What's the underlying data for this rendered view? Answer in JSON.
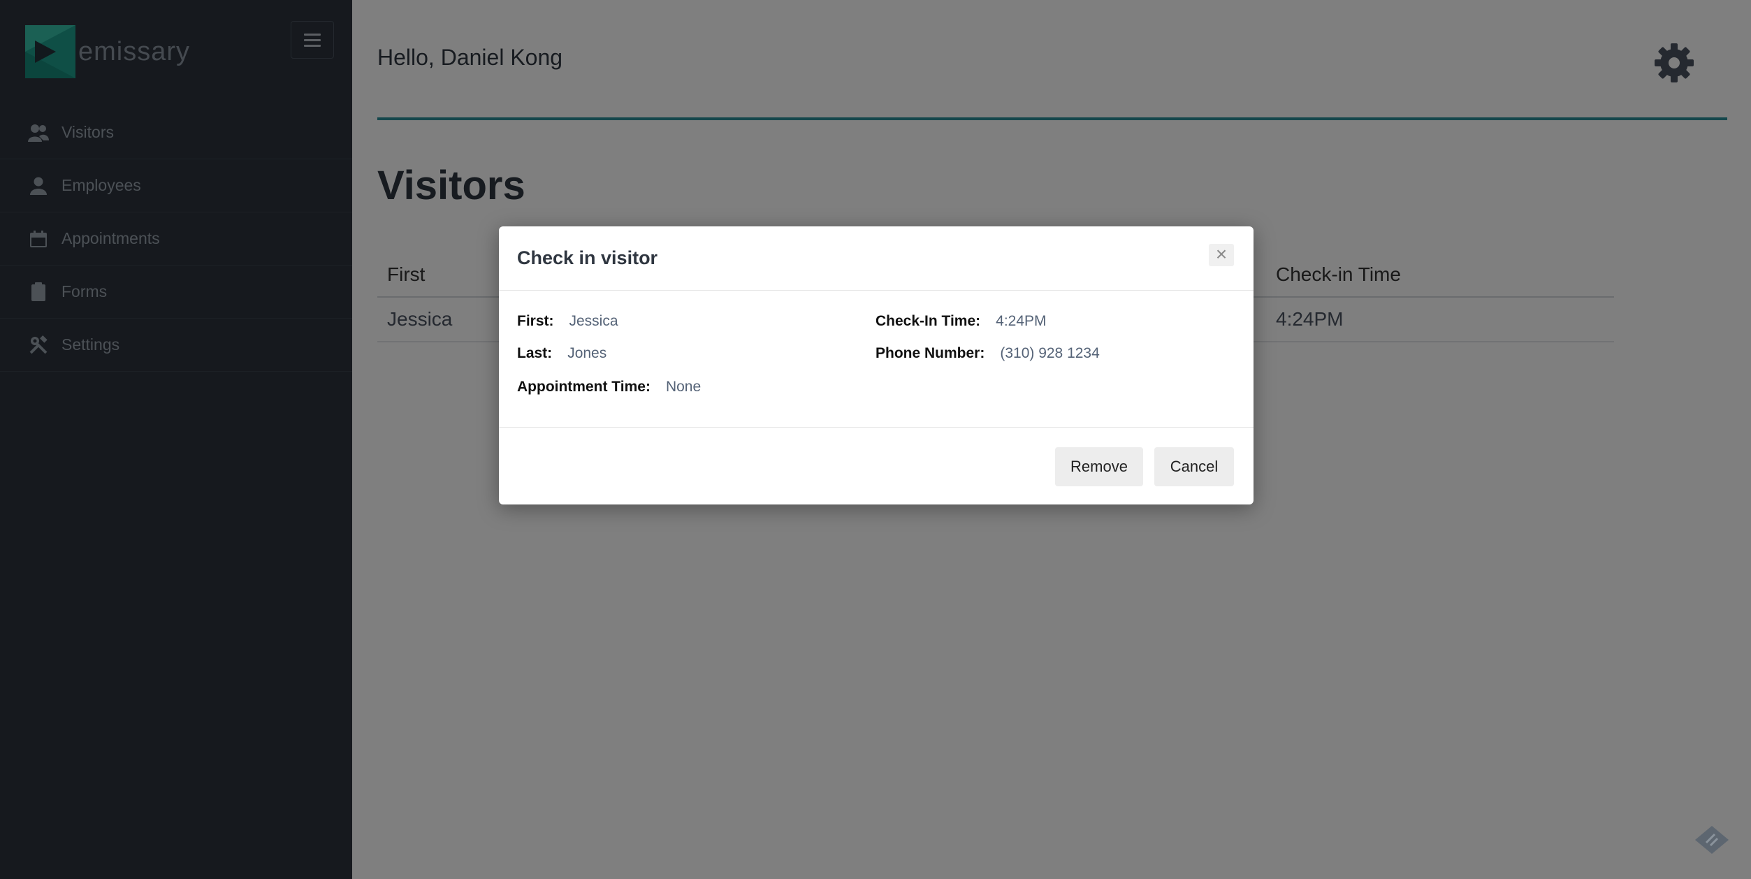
{
  "sidebar": {
    "logo_text": "emissary",
    "items": [
      {
        "label": "Visitors",
        "icon": "visitors-icon"
      },
      {
        "label": "Employees",
        "icon": "employee-icon"
      },
      {
        "label": "Appointments",
        "icon": "calendar-icon"
      },
      {
        "label": "Forms",
        "icon": "clipboard-icon"
      },
      {
        "label": "Settings",
        "icon": "tools-icon"
      }
    ]
  },
  "header": {
    "greeting": "Hello, Daniel Kong",
    "settings_icon": "gear-icon",
    "accent_color": "#2a8f98"
  },
  "main": {
    "title": "Visitors",
    "table": {
      "columns": [
        "First",
        "Check-in Time"
      ],
      "rows": [
        [
          "Jessica",
          "4:24PM"
        ]
      ]
    }
  },
  "modal": {
    "title": "Check in visitor",
    "close_glyph": "×",
    "fields": {
      "first": {
        "label": "First:",
        "value": "Jessica"
      },
      "last": {
        "label": "Last:",
        "value": "Jones"
      },
      "appointment_time": {
        "label": "Appointment Time:",
        "value": "None"
      },
      "checkin_time": {
        "label": "Check-In Time:",
        "value": "4:24PM"
      },
      "phone": {
        "label": "Phone Number:",
        "value": "(310) 928 1234"
      }
    },
    "buttons": {
      "remove": "Remove",
      "cancel": "Cancel"
    }
  }
}
